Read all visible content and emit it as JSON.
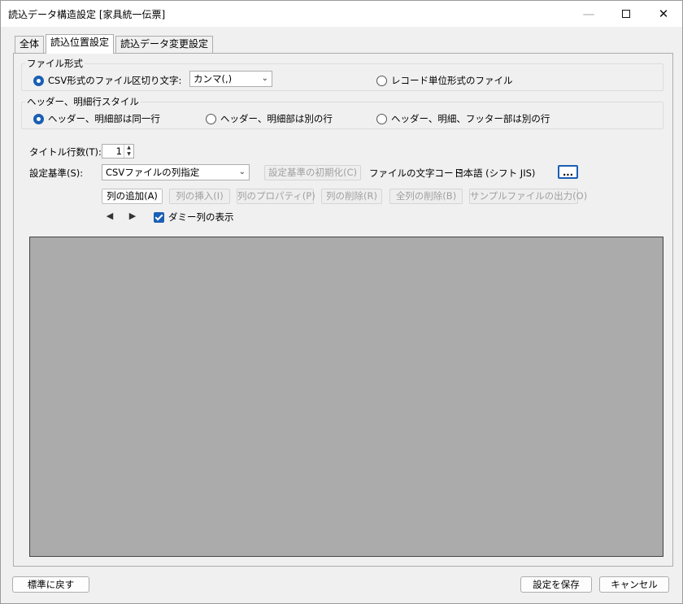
{
  "window": {
    "title": "読込データ構造設定 [家具統一伝票]",
    "minimize_glyph": "—",
    "close_glyph": "✕"
  },
  "tabs": [
    {
      "label": "全体",
      "active": false
    },
    {
      "label": "読込位置設定",
      "active": true
    },
    {
      "label": "読込データ変更設定",
      "active": false
    }
  ],
  "file_format": {
    "group_title": "ファイル形式",
    "csv_label": "CSV形式のファイル",
    "delimiter_label": "区切り文字:",
    "delimiter_value": "カンマ(,)",
    "record_label": "レコード単位形式のファイル",
    "selected": "csv"
  },
  "header_style": {
    "group_title": "ヘッダー、明細行スタイル",
    "option1": "ヘッダー、明細部は同一行",
    "option2": "ヘッダー、明細部は別の行",
    "option3": "ヘッダー、明細、フッター部は別の行",
    "selected": "option1"
  },
  "settings": {
    "title_rows_label": "タイトル行数(T):",
    "title_rows_value": "1",
    "basis_label": "設定基準(S):",
    "basis_value": "CSVファイルの列指定",
    "init_basis_button": "設定基準の初期化(C)",
    "encoding_label": "ファイルの文字コード:",
    "encoding_value": "日本語 (シフト JIS)",
    "ellipsis_button": "..."
  },
  "column_buttons": {
    "add": "列の追加(A)",
    "insert": "列の挿入(I)",
    "properties": "列のプロパティ(P)",
    "delete": "列の削除(R)",
    "delete_all": "全列の削除(B)",
    "sample_output": "サンプルファイルの出力(O)"
  },
  "nav": {
    "prev_glyph": "◀",
    "next_glyph": "▶",
    "dummy_label": "ダミー列の表示",
    "dummy_checked": true
  },
  "footer": {
    "reset_button": "標準に戻す",
    "save_button": "設定を保存",
    "cancel_button": "キャンセル"
  },
  "colors": {
    "accent": "#1a5fb4",
    "grid_background": "#ababab"
  }
}
